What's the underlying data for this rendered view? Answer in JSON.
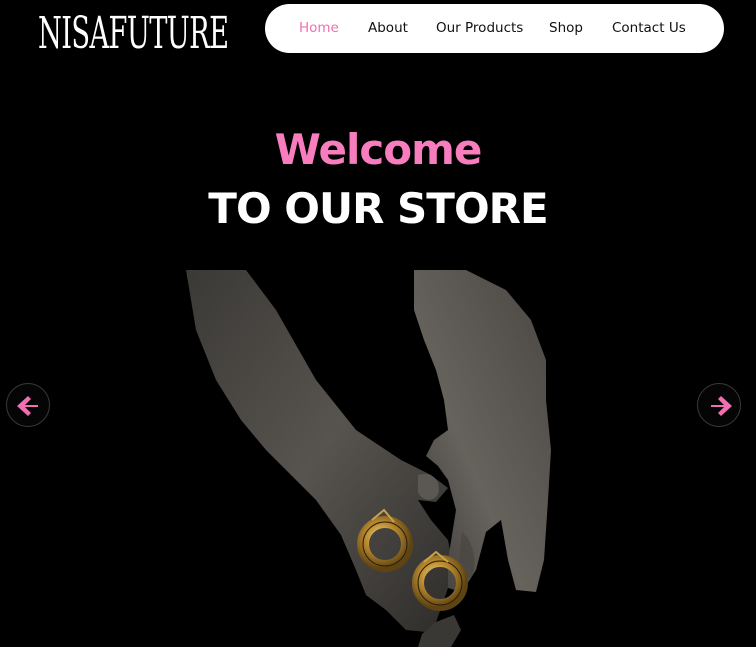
{
  "brand": {
    "logo_text": "NISAFUTURE"
  },
  "nav": {
    "items": [
      {
        "label": "Home",
        "active": true
      },
      {
        "label": "About",
        "active": false
      },
      {
        "label": "Our Products",
        "active": false
      },
      {
        "label": "Shop",
        "active": false
      },
      {
        "label": "Contact Us",
        "active": false
      }
    ]
  },
  "hero": {
    "heading": "Welcome",
    "subheading": "TO OUR STORE",
    "image": "hands-holding-gold-hoop-earrings"
  },
  "carousel": {
    "prev_icon": "arrow-left-icon",
    "next_icon": "arrow-right-icon"
  },
  "colors": {
    "accent": "#f87dbe",
    "background": "#000000",
    "nav_background": "#ffffff"
  }
}
